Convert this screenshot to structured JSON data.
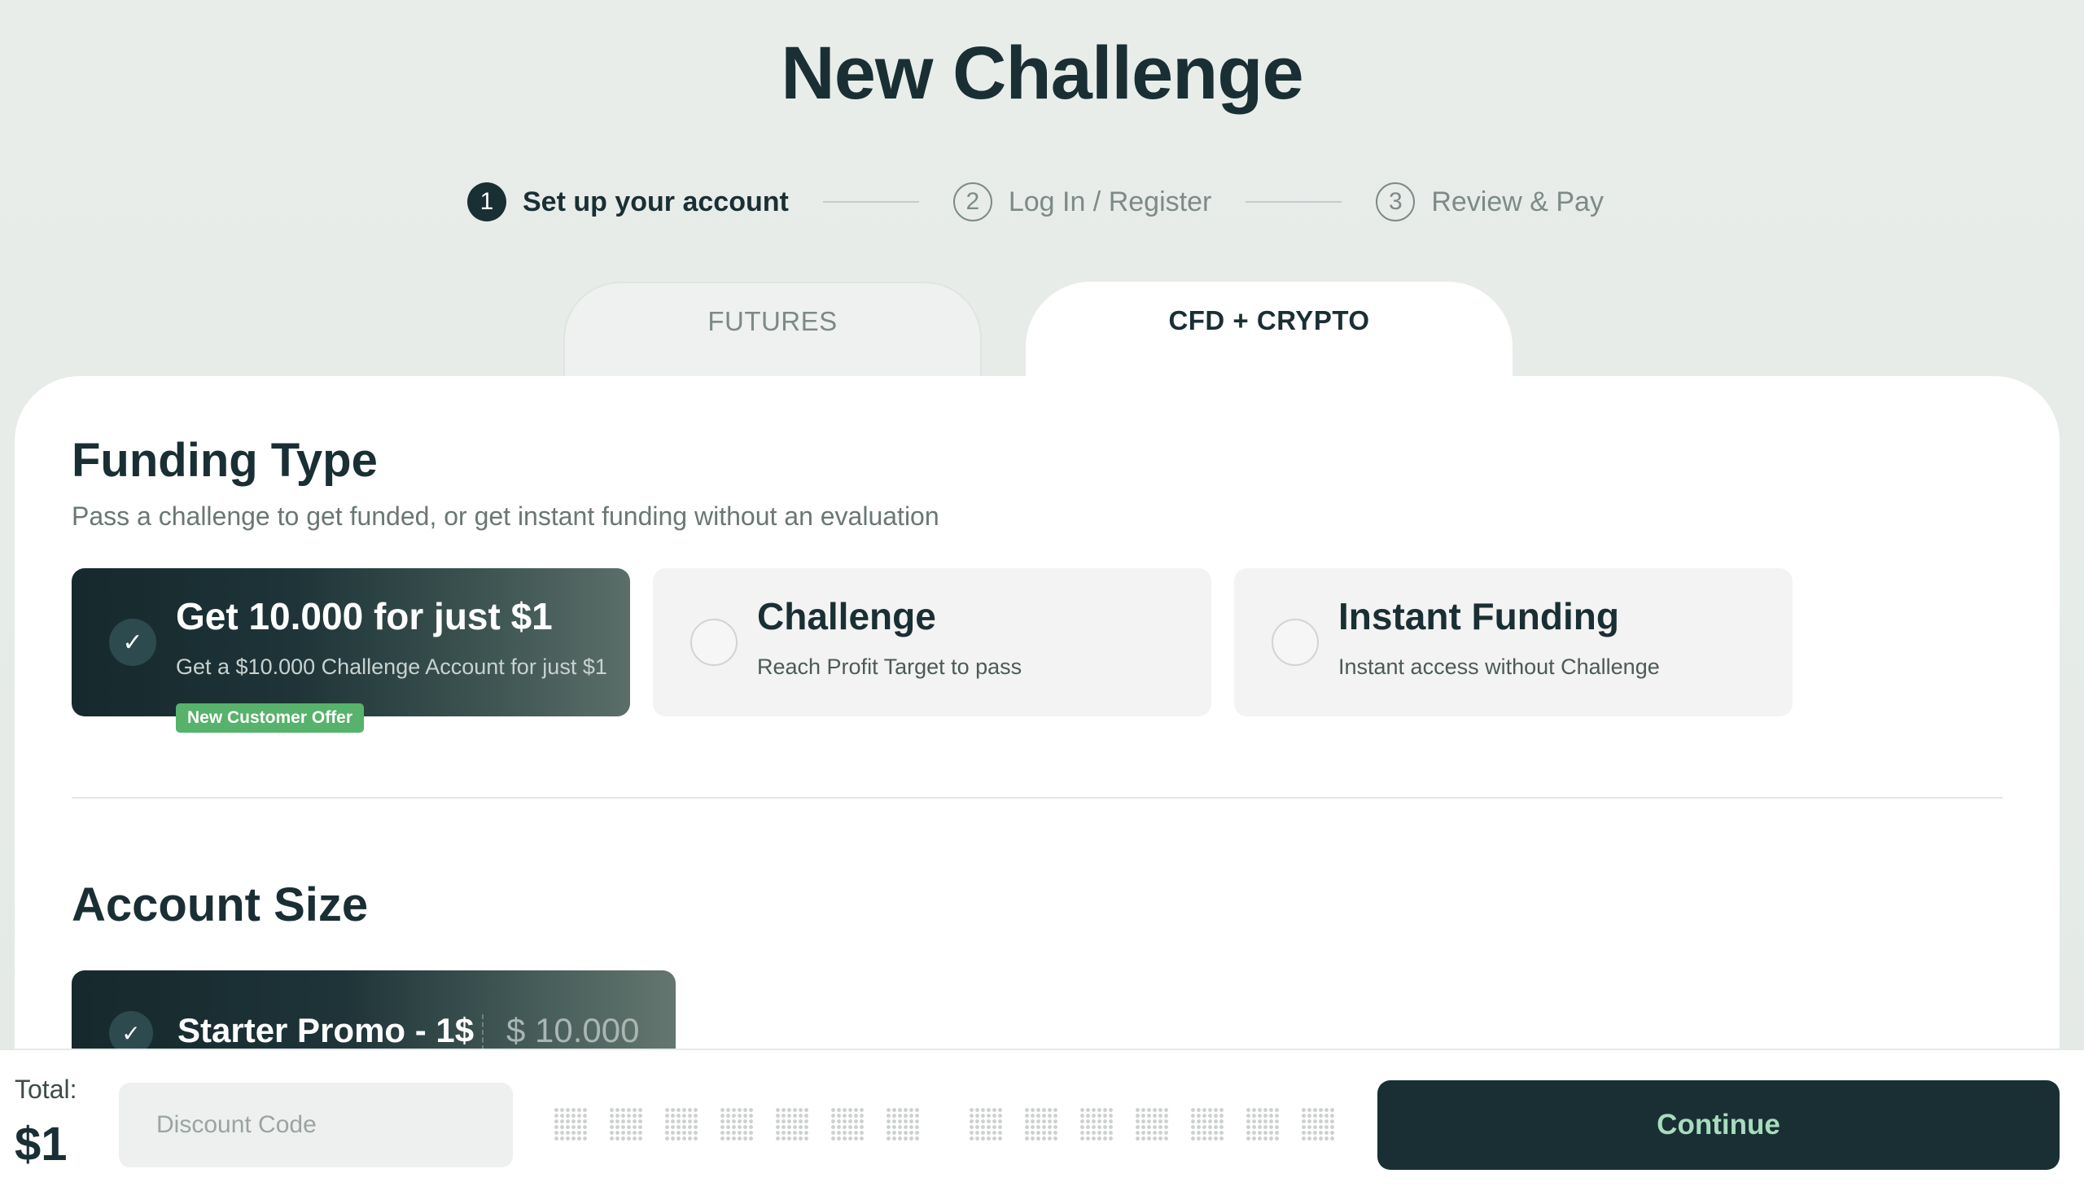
{
  "page": {
    "title": "New Challenge"
  },
  "stepper": [
    {
      "number": "1",
      "label": "Set up your account",
      "active": true
    },
    {
      "number": "2",
      "label": "Log In / Register",
      "active": false
    },
    {
      "number": "3",
      "label": "Review & Pay",
      "active": false
    }
  ],
  "tabs": [
    {
      "label": "FUTURES",
      "selected": false
    },
    {
      "label": "CFD + CRYPTO",
      "selected": true
    }
  ],
  "funding": {
    "title": "Funding Type",
    "subtitle": "Pass a challenge to get funded, or get instant funding without an evaluation",
    "options": [
      {
        "title": "Get 10.000 for just $1",
        "desc": "Get a $10.000 Challenge Account for just $1",
        "selected": true,
        "badge": "New Customer Offer"
      },
      {
        "title": "Challenge",
        "desc": "Reach Profit Target to pass",
        "selected": false
      },
      {
        "title": "Instant Funding",
        "desc": "Instant access without Challenge",
        "selected": false
      }
    ]
  },
  "account_size": {
    "title": "Account Size",
    "options": [
      {
        "name": "Starter Promo - 1$",
        "amount": "$ 10.000",
        "selected": true
      }
    ]
  },
  "footer": {
    "total_label": "Total:",
    "total_value": "$1",
    "discount_placeholder": "Discount Code",
    "continue_label": "Continue"
  },
  "icons": {
    "check": "check-icon"
  },
  "colors": {
    "primary": "#1a2f34",
    "accent": "#57b26b",
    "continue_text": "#a7dcbc"
  }
}
